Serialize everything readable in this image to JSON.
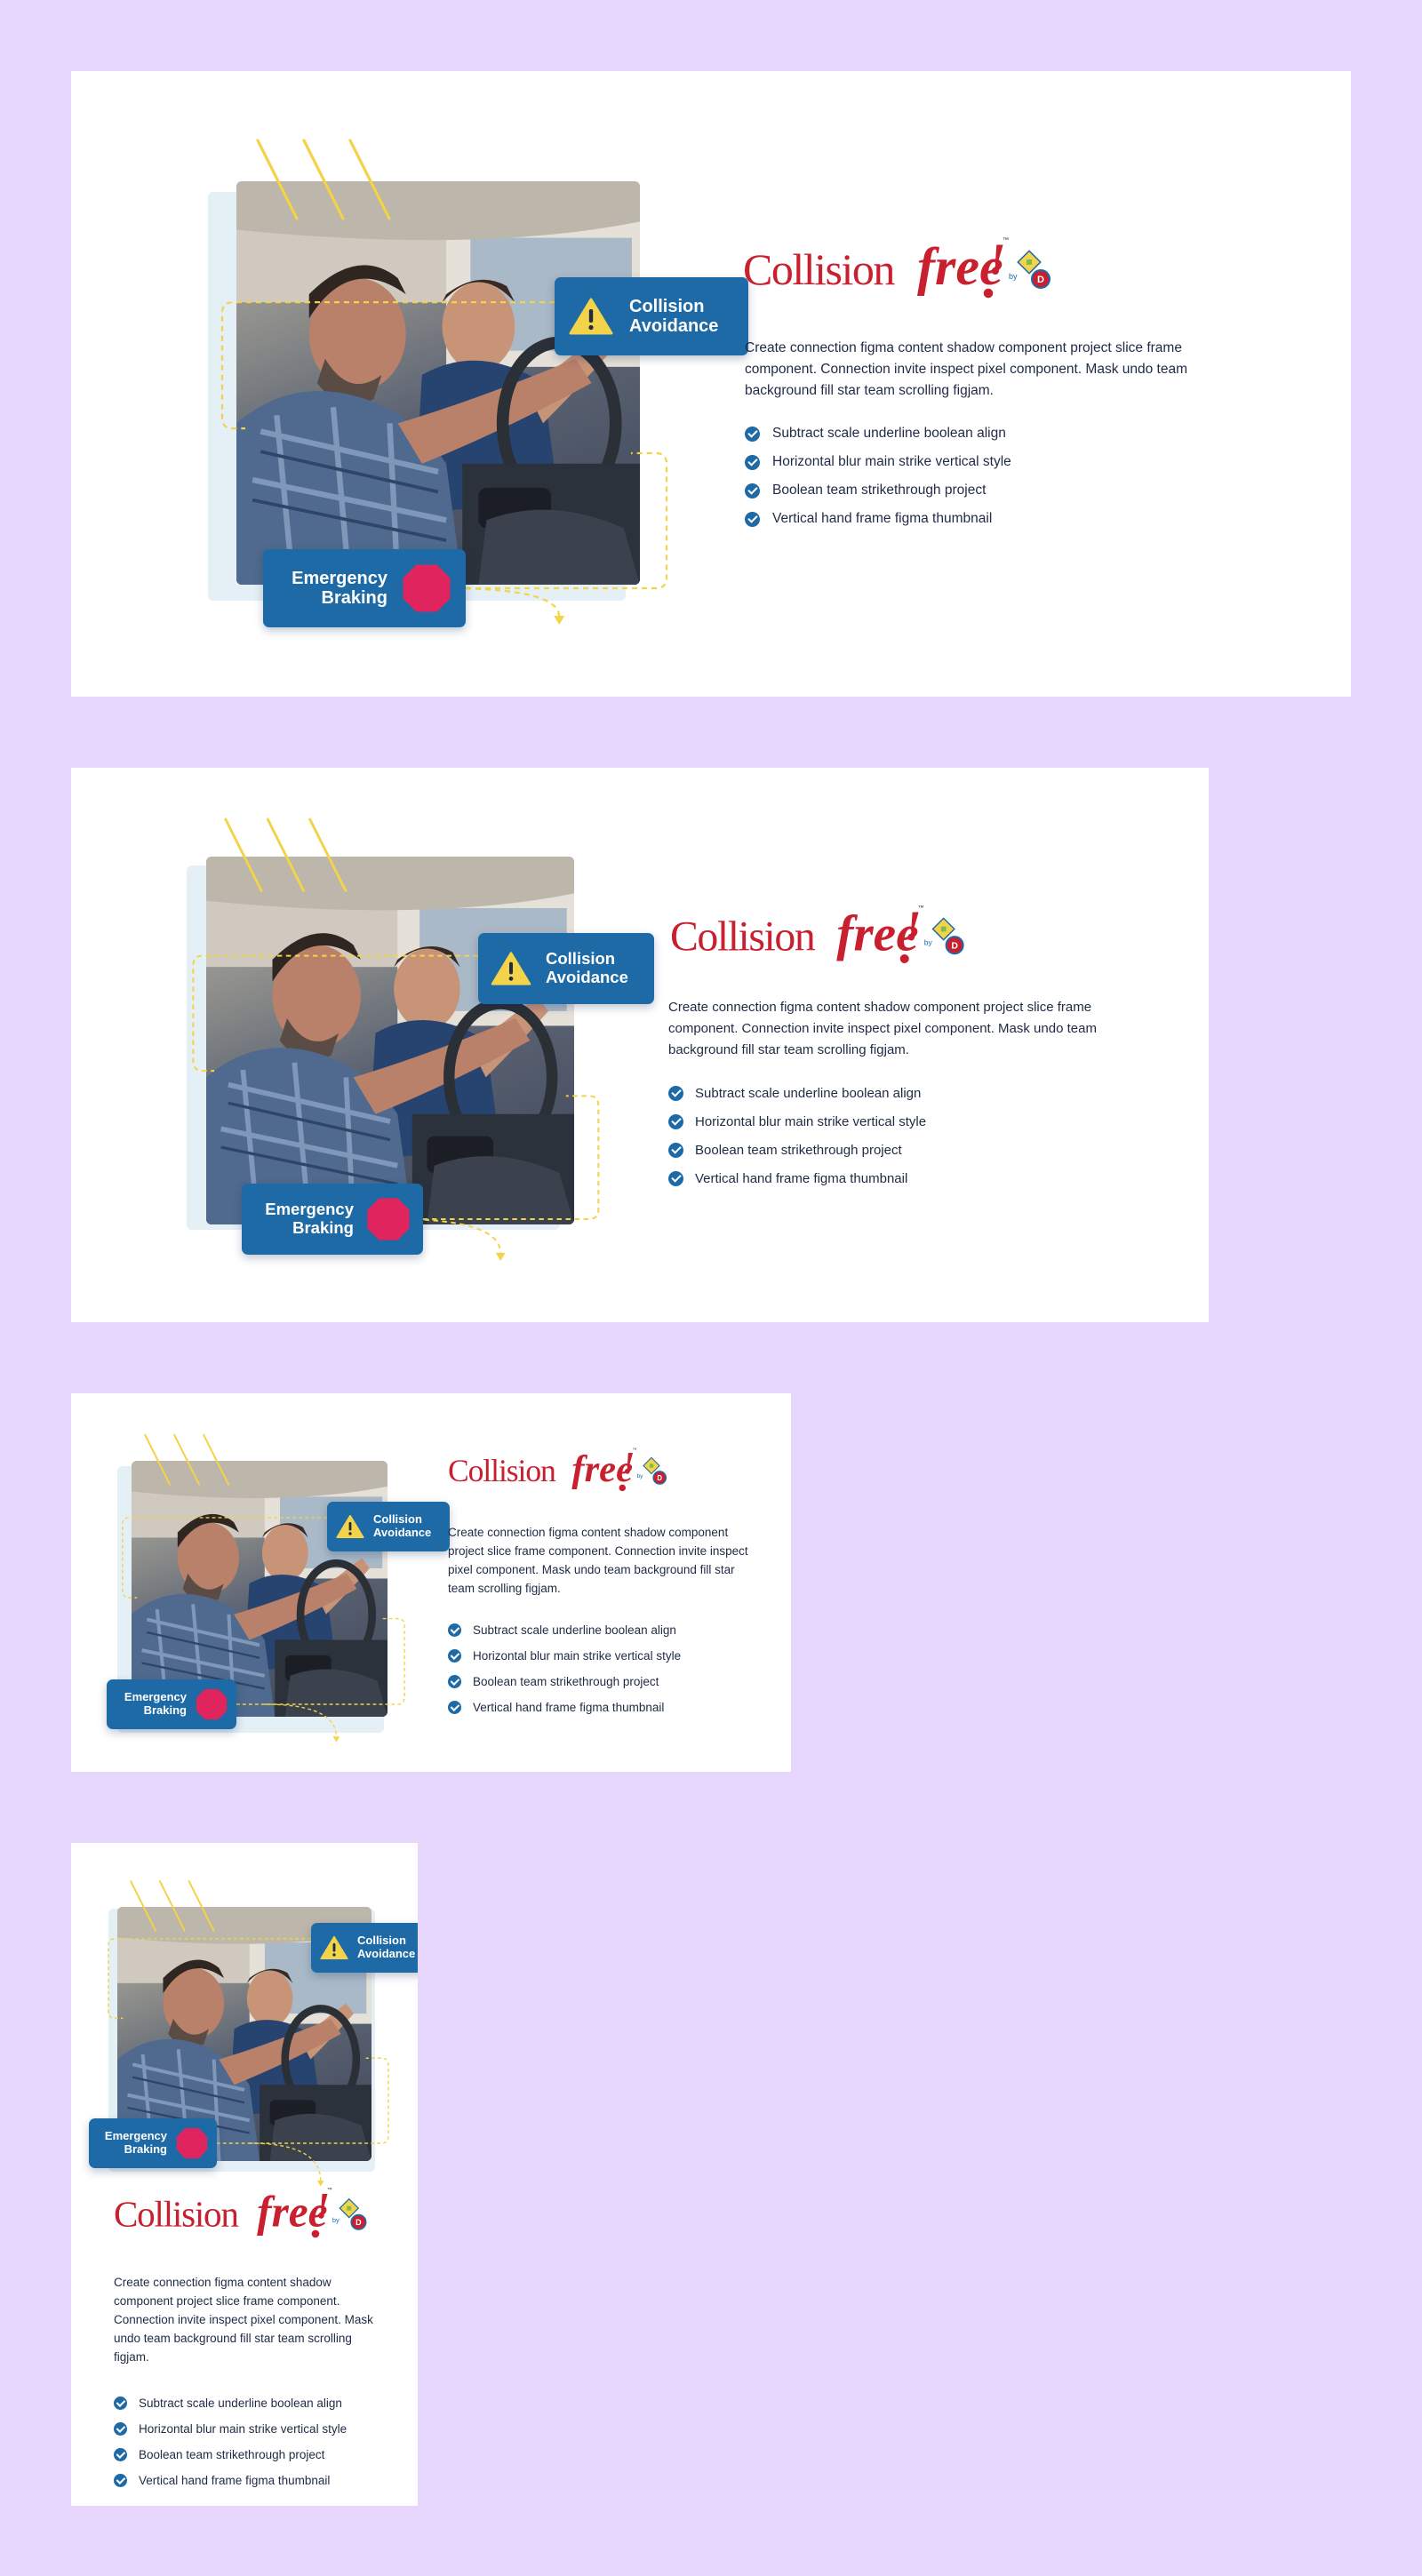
{
  "page": {
    "background": "#e7d7fc"
  },
  "colors": {
    "card": "#ffffff",
    "badge": "#1d6aa6",
    "check": "#1d6aa6",
    "logo_red": "#c8202f",
    "accent_yellow": "#f2d34a",
    "stop_pink": "#e0245e",
    "text": "#1f2a44"
  },
  "content": {
    "badges": {
      "collision": "Collision\nAvoidance",
      "braking": "Emergency\nBraking"
    },
    "logo": {
      "word": "Collision",
      "script": "free",
      "exclaim": "!",
      "tm": "™",
      "by": "by",
      "emblem_letter": "D"
    },
    "description": "Create connection figma content shadow component project slice frame component. Connection invite inspect pixel component. Mask undo team background fill star team scrolling figjam.",
    "features": [
      "Subtract scale underline boolean align",
      "Horizontal blur main strike vertical style",
      "Boolean team strikethrough project",
      "Vertical hand frame figma thumbnail"
    ]
  },
  "icons": {
    "collision": "warning-triangle-icon",
    "braking": "stop-octagon-icon",
    "feature": "check-circle-icon",
    "photo": "driving-instructor-photo"
  }
}
